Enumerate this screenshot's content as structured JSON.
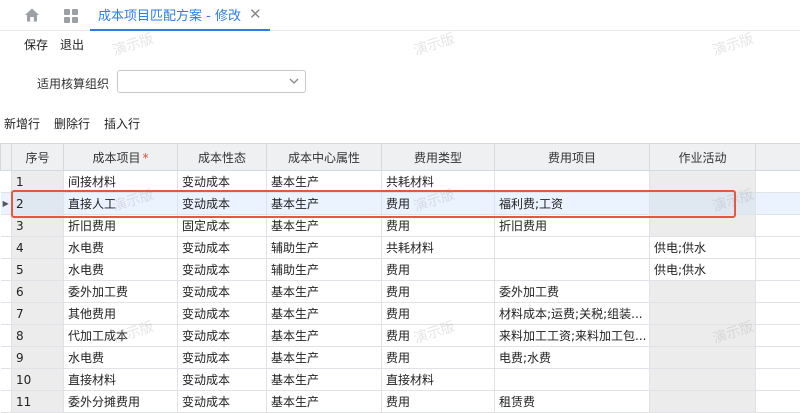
{
  "nav": {
    "home_icon": "home-icon",
    "apps_icon": "grid-icon",
    "tab_label": "成本项目匹配方案 - 修改",
    "tab_close": "✕"
  },
  "toolbar": {
    "save": "保存",
    "exit": "退出"
  },
  "filter": {
    "label": "适用核算组织",
    "value": ""
  },
  "row_actions": {
    "add": "新增行",
    "delete": "删除行",
    "insert": "插入行"
  },
  "grid": {
    "columns": [
      "序号",
      "成本项目",
      "成本性态",
      "成本中心属性",
      "费用类型",
      "费用项目",
      "作业活动"
    ],
    "required_mark": "*",
    "rows": [
      {
        "no": "1",
        "item": "间接材料",
        "behavior": "变动成本",
        "center": "基本生产",
        "fee_type": "共耗材料",
        "fee_item": "",
        "activity": ""
      },
      {
        "no": "2",
        "item": "直接人工",
        "behavior": "变动成本",
        "center": "基本生产",
        "fee_type": "费用",
        "fee_item": "福利费;工资",
        "activity": ""
      },
      {
        "no": "3",
        "item": "折旧费用",
        "behavior": "固定成本",
        "center": "基本生产",
        "fee_type": "费用",
        "fee_item": "折旧费用",
        "activity": ""
      },
      {
        "no": "4",
        "item": "水电费",
        "behavior": "变动成本",
        "center": "辅助生产",
        "fee_type": "共耗材料",
        "fee_item": "",
        "activity": "供电;供水"
      },
      {
        "no": "5",
        "item": "水电费",
        "behavior": "变动成本",
        "center": "辅助生产",
        "fee_type": "费用",
        "fee_item": "",
        "activity": "供电;供水"
      },
      {
        "no": "6",
        "item": "委外加工费",
        "behavior": "变动成本",
        "center": "基本生产",
        "fee_type": "费用",
        "fee_item": "委外加工费",
        "activity": ""
      },
      {
        "no": "7",
        "item": "其他费用",
        "behavior": "变动成本",
        "center": "基本生产",
        "fee_type": "费用",
        "fee_item": "材料成本;运费;关税;组装...",
        "activity": ""
      },
      {
        "no": "8",
        "item": "代加工成本",
        "behavior": "变动成本",
        "center": "基本生产",
        "fee_type": "费用",
        "fee_item": "来料加工工资;来料加工包...",
        "activity": ""
      },
      {
        "no": "9",
        "item": "水电费",
        "behavior": "变动成本",
        "center": "基本生产",
        "fee_type": "费用",
        "fee_item": "电费;水费",
        "activity": ""
      },
      {
        "no": "10",
        "item": "直接材料",
        "behavior": "变动成本",
        "center": "基本生产",
        "fee_type": "直接材料",
        "fee_item": "",
        "activity": ""
      },
      {
        "no": "11",
        "item": "委外分摊费用",
        "behavior": "变动成本",
        "center": "基本生产",
        "fee_type": "费用",
        "fee_item": "租赁费",
        "activity": ""
      }
    ]
  },
  "watermark_text": "演示版",
  "colors": {
    "accent": "#2b7de9",
    "highlight": "#e8563f",
    "header_bg": "#eef0f2",
    "readonly_bg": "#ececec"
  }
}
